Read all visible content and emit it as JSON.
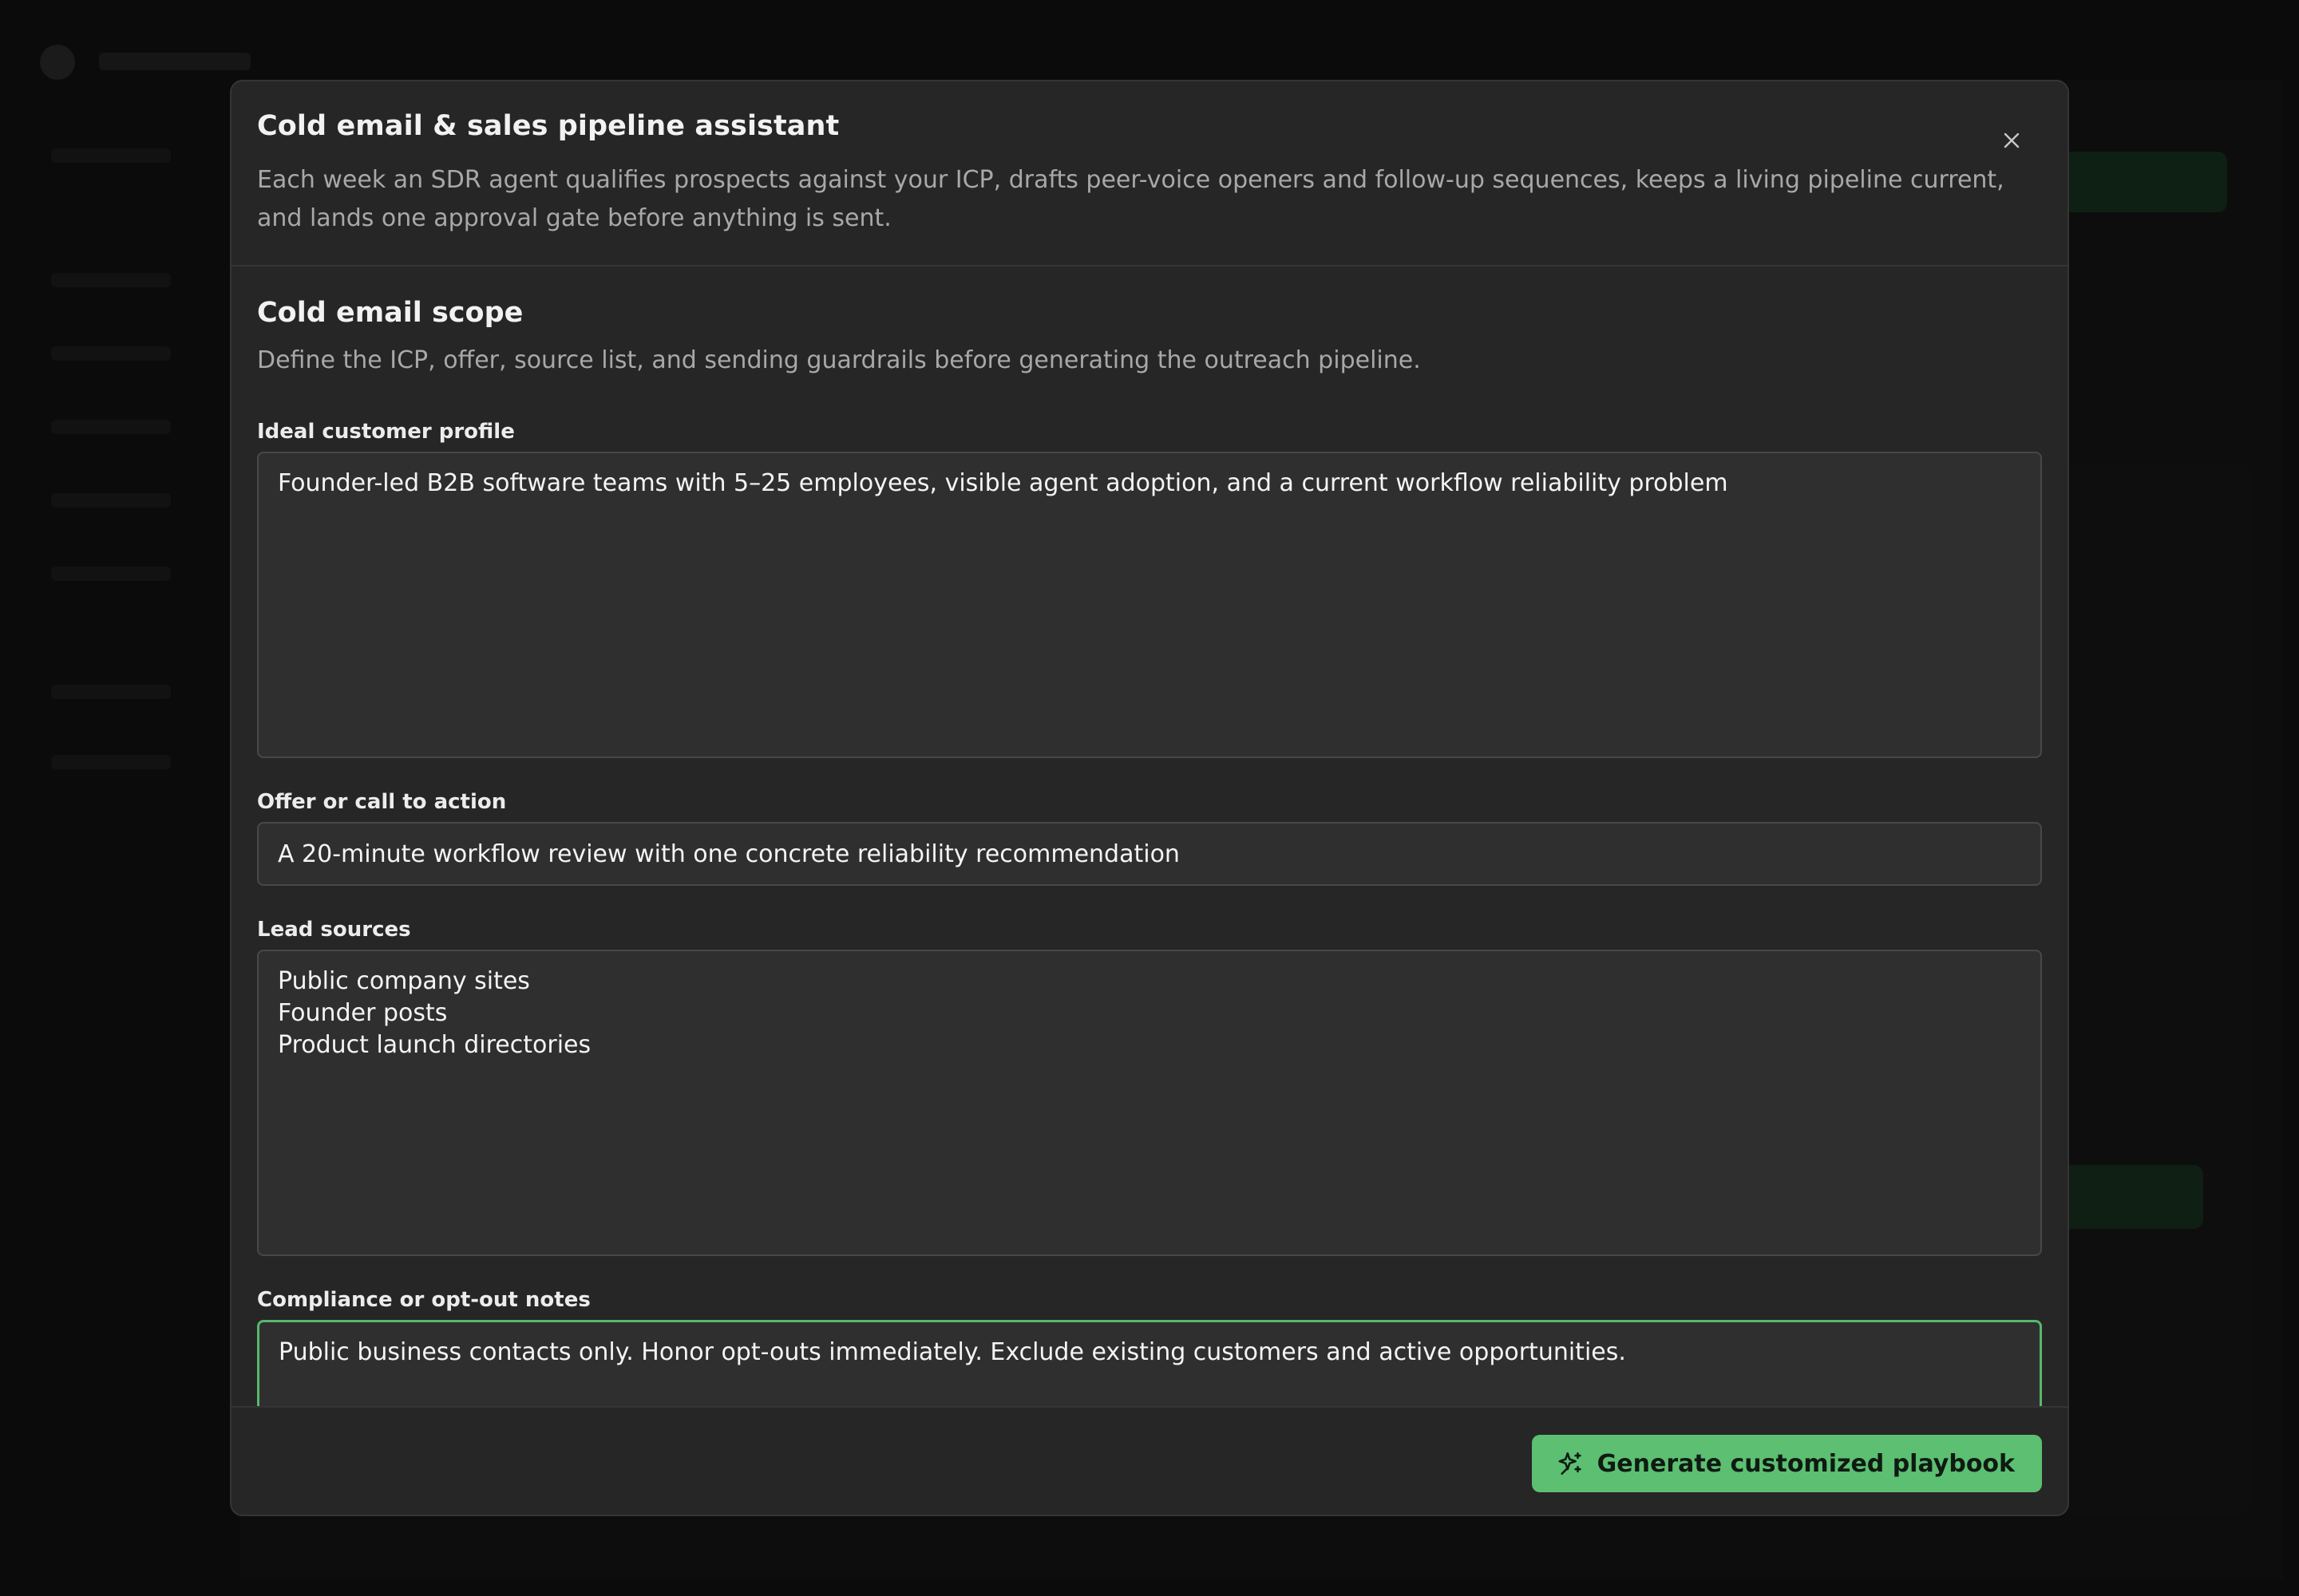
{
  "modal": {
    "title": "Cold email & sales pipeline assistant",
    "subtitle": "Each week an SDR agent qualifies prospects against your ICP, drafts peer-voice openers and follow-up sequences, keeps a living pipeline current, and lands one approval gate before anything is sent.",
    "close_icon": "close-icon"
  },
  "scope": {
    "title": "Cold email scope",
    "description": "Define the ICP, offer, source list, and sending guardrails before generating the outreach pipeline."
  },
  "fields": {
    "icp": {
      "label": "Ideal customer profile",
      "value": "Founder-led B2B software teams with 5–25 employees, visible agent adoption, and a current workflow reliability problem"
    },
    "offer": {
      "label": "Offer or call to action",
      "value": "A 20-minute workflow review with one concrete reliability recommendation"
    },
    "lead_sources": {
      "label": "Lead sources",
      "value": "Public company sites\nFounder posts\nProduct launch directories"
    },
    "compliance": {
      "label": "Compliance or opt-out notes",
      "value": "Public business contacts only. Honor opt-outs immediately. Exclude existing customers and active opportunities."
    }
  },
  "footer": {
    "generate_label": "Generate customized playbook",
    "generate_icon": "sparkles-icon"
  },
  "colors": {
    "accent": "#5cbf72",
    "focus_border": "#57b86c",
    "modal_bg": "#262626",
    "field_bg": "#2f2f2f"
  }
}
